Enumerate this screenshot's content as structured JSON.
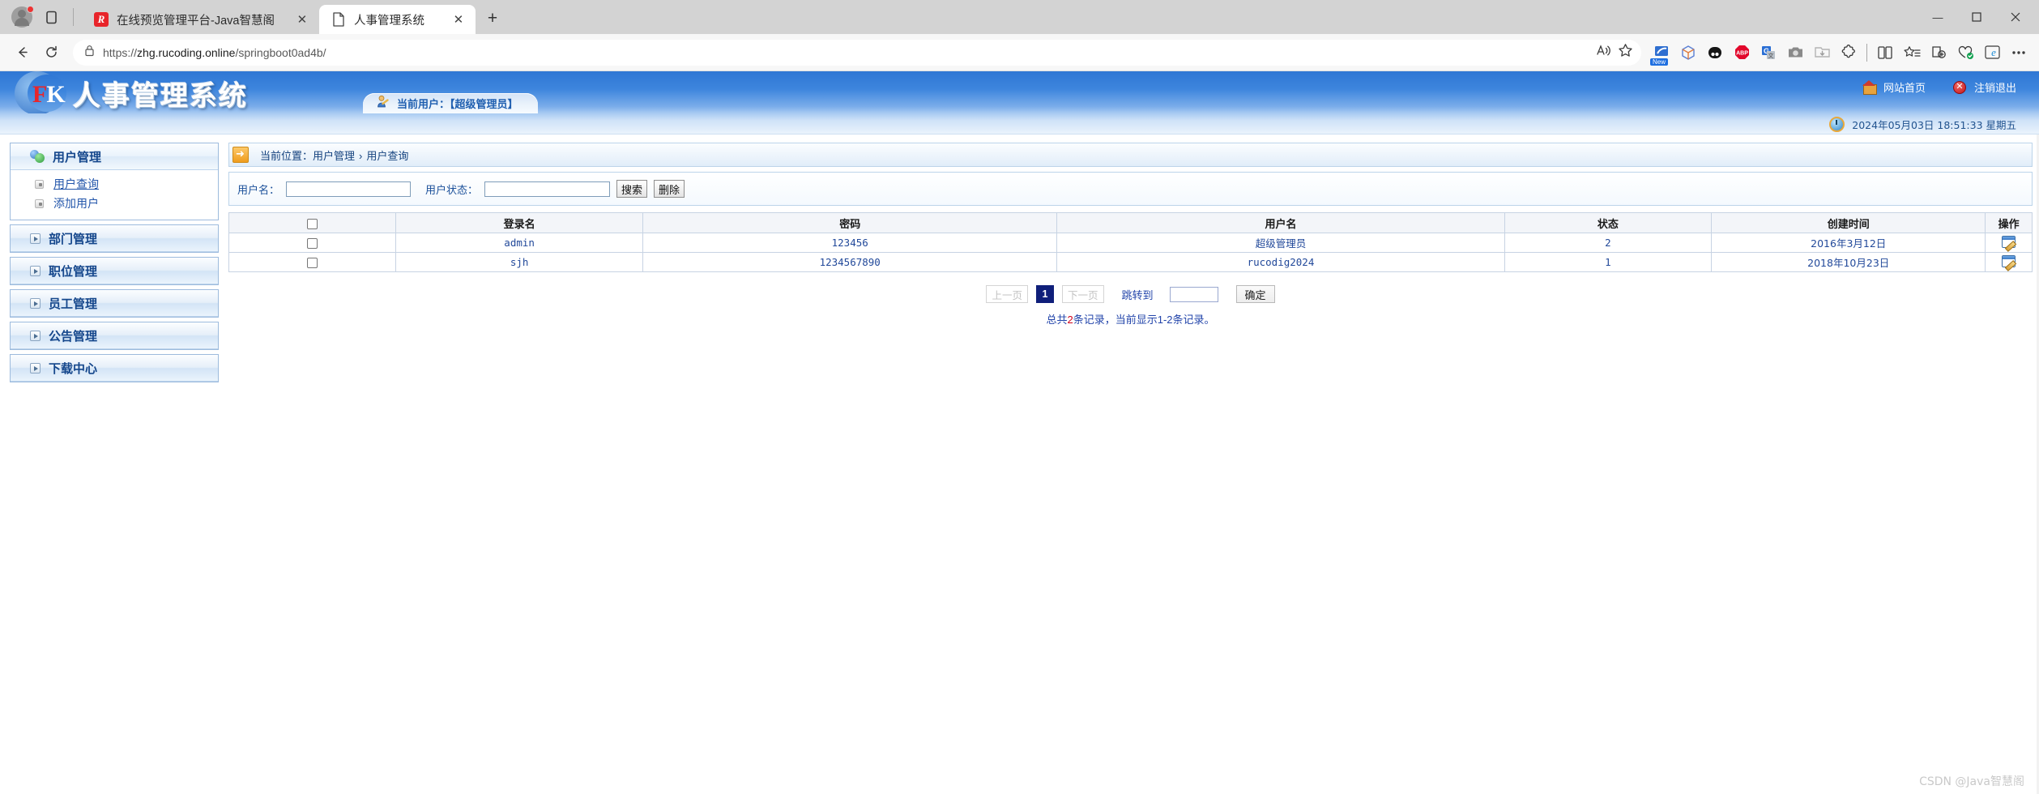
{
  "browser": {
    "tabs": [
      {
        "title": "在线预览管理平台-Java智慧阁",
        "favicon": "r-logo-icon",
        "active": false,
        "close_label": "✕"
      },
      {
        "title": "人事管理系统",
        "favicon": "document-icon",
        "active": true,
        "close_label": "✕"
      }
    ],
    "new_tab_label": "+",
    "window_controls": {
      "minimize": "—",
      "maximize": "▢",
      "close": "✕"
    },
    "nav": {
      "back": "←",
      "forward": "→",
      "reload": "⟳"
    },
    "omnibox": {
      "lock_icon": "lock-icon",
      "url_scheme": "https://",
      "url_host": "zhg.rucoding.online",
      "url_path": "/springboot0ad4b/",
      "read_aloud_icon": "read-aloud-icon",
      "favorite_icon": "star-icon"
    },
    "extensions": [
      {
        "name": "new-badge-extension-icon",
        "label": "New"
      },
      {
        "name": "cube-extension-icon",
        "label": ""
      },
      {
        "name": "dark-oval-extension-icon",
        "label": ""
      },
      {
        "name": "adblock-plus-icon",
        "label": "ABP"
      },
      {
        "name": "google-translate-icon",
        "label": "G"
      },
      {
        "name": "camera-capture-icon",
        "label": ""
      },
      {
        "name": "download-icon",
        "label": ""
      }
    ],
    "toolbar_right": [
      {
        "name": "downloads-icon"
      },
      {
        "name": "extensions-puzzle-icon"
      },
      {
        "name": "split-screen-icon"
      },
      {
        "name": "favorites-icon"
      },
      {
        "name": "collections-icon"
      },
      {
        "name": "browser-essentials-icon"
      },
      {
        "name": "ie-mode-icon"
      },
      {
        "name": "settings-more-icon"
      }
    ]
  },
  "app": {
    "logo": {
      "mark_f": "F",
      "mark_k": "K",
      "title": "人事管理系统"
    },
    "current_user": "当前用户：【超级管理员】",
    "header_links": [
      {
        "icon": "home-icon",
        "label": "网站首页"
      },
      {
        "icon": "logout-icon",
        "label": "注销退出"
      }
    ],
    "datetime": "2024年05月03日 18:51:33 星期五",
    "datetime_icon": "clock-icon"
  },
  "sidebar": {
    "blocks": [
      {
        "label": "用户管理",
        "icon": "users-icon",
        "expanded": true,
        "items": [
          {
            "label": "用户查询",
            "active": true
          },
          {
            "label": "添加用户",
            "active": false
          }
        ]
      },
      {
        "label": "部门管理",
        "icon": "expand-box-icon",
        "expanded": false,
        "items": []
      },
      {
        "label": "职位管理",
        "icon": "expand-box-icon",
        "expanded": false,
        "items": []
      },
      {
        "label": "员工管理",
        "icon": "expand-box-icon",
        "expanded": false,
        "items": []
      },
      {
        "label": "公告管理",
        "icon": "expand-box-icon",
        "expanded": false,
        "items": []
      },
      {
        "label": "下载中心",
        "icon": "expand-box-icon",
        "expanded": false,
        "items": []
      }
    ]
  },
  "breadcrumb": {
    "icon": "arrow-right-icon",
    "prefix": "当前位置：",
    "parent": "用户管理",
    "separator": "›",
    "current": "用户查询"
  },
  "search_form": {
    "username_label": "用户名：",
    "username_value": "",
    "username_placeholder": "",
    "status_label": "用户状态：",
    "status_value": "",
    "status_placeholder": "",
    "search_button": "搜索",
    "delete_button": "删除"
  },
  "table": {
    "select_all_checked": false,
    "columns": [
      "",
      "登录名",
      "密码",
      "用户名",
      "状态",
      "创建时间",
      "操作"
    ],
    "rows": [
      {
        "checked": false,
        "login": "admin",
        "password": "123456",
        "username": "超级管理员",
        "status": "2",
        "created": "2016年3月12日",
        "action_icon": "edit-icon"
      },
      {
        "checked": false,
        "login": "sjh",
        "password": "1234567890",
        "username": "rucodig2024",
        "status": "1",
        "created": "2018年10月23日",
        "action_icon": "edit-icon"
      }
    ]
  },
  "pagination": {
    "prev": "上一页",
    "current_page": "1",
    "next": "下一页",
    "jump_label": "跳转到",
    "jump_value": "",
    "confirm_button": "确定",
    "summary_prefix": "总共",
    "summary_total": "2",
    "summary_middle": "条记录，当前显示1-2条记录。"
  },
  "watermark": "CSDN @Java智慧阁"
}
